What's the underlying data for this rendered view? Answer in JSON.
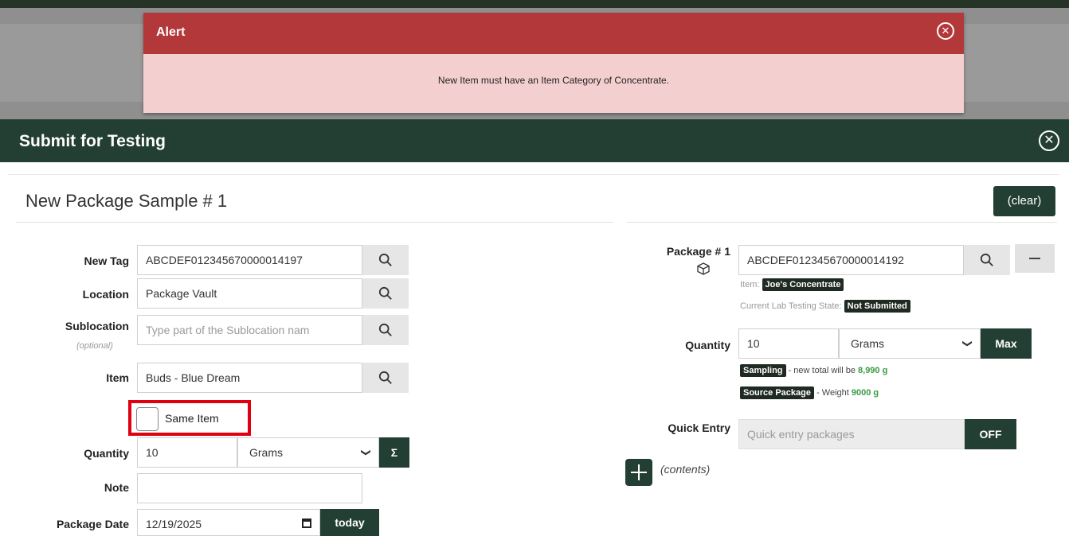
{
  "alert": {
    "title": "Alert",
    "message": "New Item must have an Item Category of Concentrate."
  },
  "modal": {
    "title": "Submit for Testing",
    "section_title": "New Package Sample # 1",
    "clear_label": "(clear)"
  },
  "form": {
    "new_tag": {
      "label": "New Tag",
      "value": "ABCDEF012345670000014197"
    },
    "location": {
      "label": "Location",
      "value": "Package Vault"
    },
    "sublocation": {
      "label": "Sublocation",
      "hint": "(optional)",
      "placeholder": "Type part of the Sublocation nam"
    },
    "item": {
      "label": "Item",
      "value": "Buds - Blue Dream"
    },
    "same_item": {
      "label": "Same Item",
      "checked": false
    },
    "quantity": {
      "label": "Quantity",
      "value": "10",
      "unit": "Grams",
      "sum_label": "Σ"
    },
    "note": {
      "label": "Note",
      "value": ""
    },
    "package_date": {
      "label": "Package Date",
      "value": "12/19/2025",
      "today_label": "today"
    }
  },
  "package": {
    "label": "Package # 1",
    "tag": "ABCDEF012345670000014192",
    "item_prefix": "Item:",
    "item_name": "Joe's Concentrate",
    "lab_state_prefix": "Current Lab Testing State:",
    "lab_state": "Not Submitted",
    "quantity_label": "Quantity",
    "quantity_value": "10",
    "quantity_unit": "Grams",
    "max_label": "Max",
    "sampling_badge": "Sampling",
    "sampling_text": "- new total will be",
    "sampling_total": "8,990 g",
    "source_badge": "Source Package",
    "source_text": "- Weight",
    "source_weight": "9000 g"
  },
  "quick_entry": {
    "label": "Quick Entry",
    "placeholder": "Quick entry packages",
    "toggle_label": "OFF"
  },
  "contents_label": "(contents)",
  "colors": {
    "header_green": "#233f34",
    "alert_red": "#b3383a",
    "alert_bg": "#f4cfcf",
    "highlight_red": "#e00010",
    "value_green": "#3a9b44"
  }
}
